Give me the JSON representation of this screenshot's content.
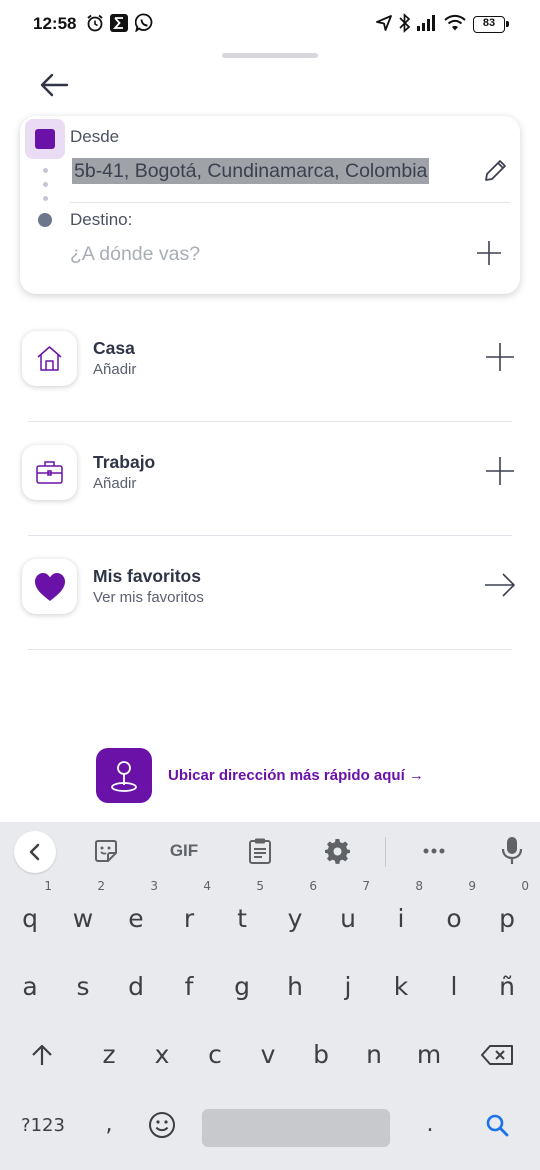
{
  "status_bar": {
    "time": "12:58",
    "battery": "83",
    "icons": [
      "alarm-icon",
      "sigma-app-icon",
      "whatsapp-icon",
      "location-arrow-icon",
      "bluetooth-icon",
      "signal-icon",
      "wifi-icon",
      "battery-icon"
    ]
  },
  "route": {
    "from_label": "Desde",
    "from_value": "5b-41, Bogotá, Cundinamarca, Colombia",
    "to_label": "Destino:",
    "to_placeholder": "¿A dónde vas?"
  },
  "places": [
    {
      "title": "Casa",
      "subtitle": "Añadir",
      "icon": "house-icon",
      "action": "plus-icon"
    },
    {
      "title": "Trabajo",
      "subtitle": "Añadir",
      "icon": "briefcase-icon",
      "action": "plus-icon"
    },
    {
      "title": "Mis favoritos",
      "subtitle": "Ver mis favoritos",
      "icon": "heart-icon",
      "action": "arrow-right-icon"
    }
  ],
  "quick_locate": {
    "label": "Ubicar dirección más rápido aquí →",
    "icon": "map-pin-icon"
  },
  "keyboard": {
    "toolbar": {
      "gif_label": "GIF"
    },
    "row1": [
      "q",
      "w",
      "e",
      "r",
      "t",
      "y",
      "u",
      "i",
      "o",
      "p"
    ],
    "row1_numbers": [
      "1",
      "2",
      "3",
      "4",
      "5",
      "6",
      "7",
      "8",
      "9",
      "0"
    ],
    "row2": [
      "a",
      "s",
      "d",
      "f",
      "g",
      "h",
      "j",
      "k",
      "l",
      "ñ"
    ],
    "row3": [
      "z",
      "x",
      "c",
      "v",
      "b",
      "n",
      "m"
    ],
    "symbols_label": "?123",
    "comma": ",",
    "period": "."
  },
  "colors": {
    "brand_purple": "#6a12a8",
    "text_dark": "#2f3446",
    "keyboard_bg": "#e8eaed"
  }
}
